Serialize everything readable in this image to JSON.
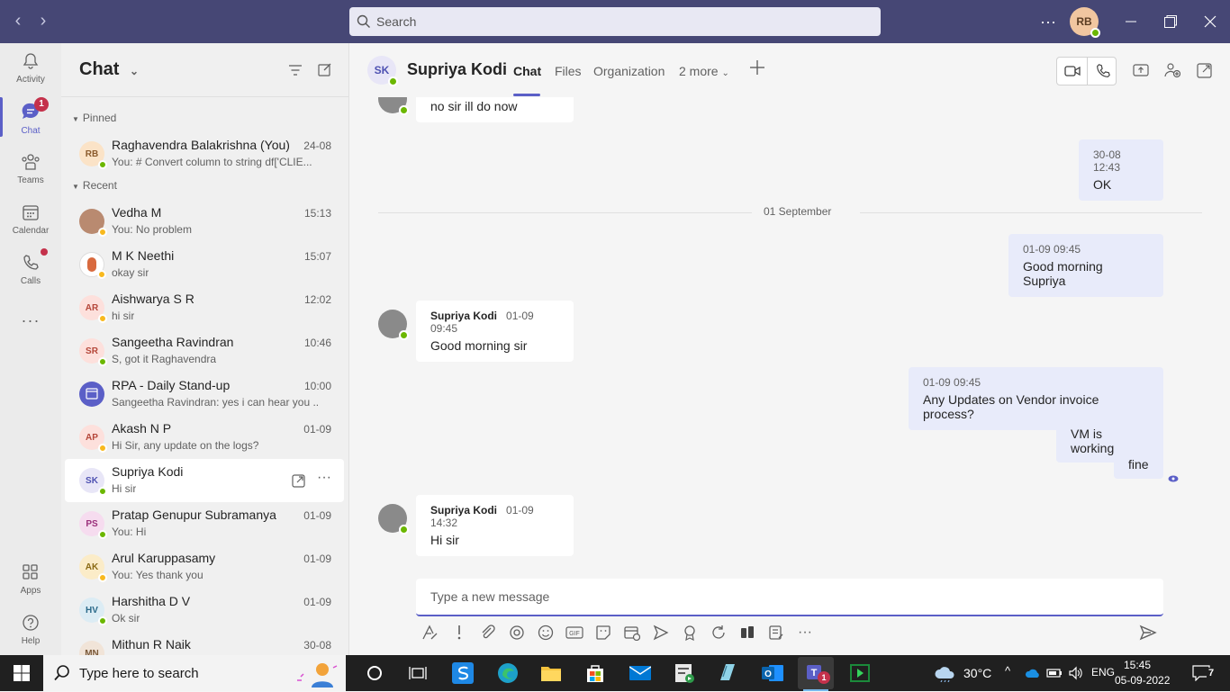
{
  "titlebar": {
    "search_placeholder": "Search",
    "me_initials": "RB"
  },
  "apprail": {
    "items": [
      {
        "label": "Activity"
      },
      {
        "label": "Chat",
        "badge": "1"
      },
      {
        "label": "Teams"
      },
      {
        "label": "Calendar"
      },
      {
        "label": "Calls"
      },
      {
        "label": "Apps"
      },
      {
        "label": "Help"
      }
    ]
  },
  "chatlist": {
    "title": "Chat",
    "pinned_label": "Pinned",
    "recent_label": "Recent",
    "pinned": [
      {
        "initials": "RB",
        "name": "Raghavendra Balakrishna (You)",
        "preview": "You: # Convert column to string df['CLIE...",
        "time": "24-08"
      }
    ],
    "recent": [
      {
        "initials": "",
        "name": "Vedha M",
        "preview": "You: No problem",
        "time": "15:13"
      },
      {
        "initials": "",
        "name": "M K Neethi",
        "preview": "okay sir",
        "time": "15:07"
      },
      {
        "initials": "AR",
        "name": "Aishwarya S R",
        "preview": "hi sir",
        "time": "12:02"
      },
      {
        "initials": "SR",
        "name": "Sangeetha Ravindran",
        "preview": "S, got it Raghavendra",
        "time": "10:46"
      },
      {
        "initials": "",
        "name": "RPA - Daily Stand-up",
        "preview": "Sangeetha Ravindran: yes i can hear you ...",
        "time": "10:00"
      },
      {
        "initials": "AP",
        "name": "Akash N P",
        "preview": "Hi Sir, any update on the logs?",
        "time": "01-09"
      },
      {
        "initials": "SK",
        "name": "Supriya Kodi",
        "preview": "Hi sir",
        "time": ""
      },
      {
        "initials": "PS",
        "name": "Pratap Genupur Subramanya",
        "preview": "You: Hi",
        "time": "01-09"
      },
      {
        "initials": "AK",
        "name": "Arul Karuppasamy",
        "preview": "You: Yes thank you",
        "time": "01-09"
      },
      {
        "initials": "HV",
        "name": "Harshitha D V",
        "preview": "Ok sir",
        "time": "01-09"
      },
      {
        "initials": "MN",
        "name": "Mithun R Naik",
        "preview": "",
        "time": "30-08"
      }
    ]
  },
  "conversation": {
    "initials": "SK",
    "name": "Supriya Kodi",
    "tabs": [
      "Chat",
      "Files",
      "Organization",
      "2 more"
    ],
    "date_divider": "01 September",
    "messages": [
      {
        "dir": "in",
        "sender": "",
        "time": "",
        "text": "no sir ill do now"
      },
      {
        "dir": "out",
        "time": "30-08 12:43",
        "text": "OK"
      },
      {
        "dir": "out",
        "time": "01-09 09:45",
        "text": "Good morning Supriya"
      },
      {
        "dir": "in",
        "sender": "Supriya Kodi",
        "time": "01-09 09:45",
        "text": "Good morning sir"
      },
      {
        "dir": "out",
        "time": "01-09 09:45",
        "text": "Any Updates on Vendor invoice process?"
      },
      {
        "dir": "out",
        "time": "",
        "text": "VM is working"
      },
      {
        "dir": "out",
        "time": "",
        "text": "fine"
      },
      {
        "dir": "in",
        "sender": "Supriya Kodi",
        "time": "01-09 14:32",
        "text": "Hi sir"
      }
    ],
    "composer_placeholder": "Type a new message"
  },
  "taskbar": {
    "search_text": "Type here to search",
    "weather": "30°C",
    "language": "ENG",
    "time": "15:45",
    "date": "05-09-2022",
    "notification_count": "7"
  },
  "colors": {
    "titlebar": "#464775",
    "accent": "#5b5fc7",
    "outgoing_bubble": "#e8ebfa",
    "online": "#6bb700",
    "away": "#f8b91e"
  }
}
